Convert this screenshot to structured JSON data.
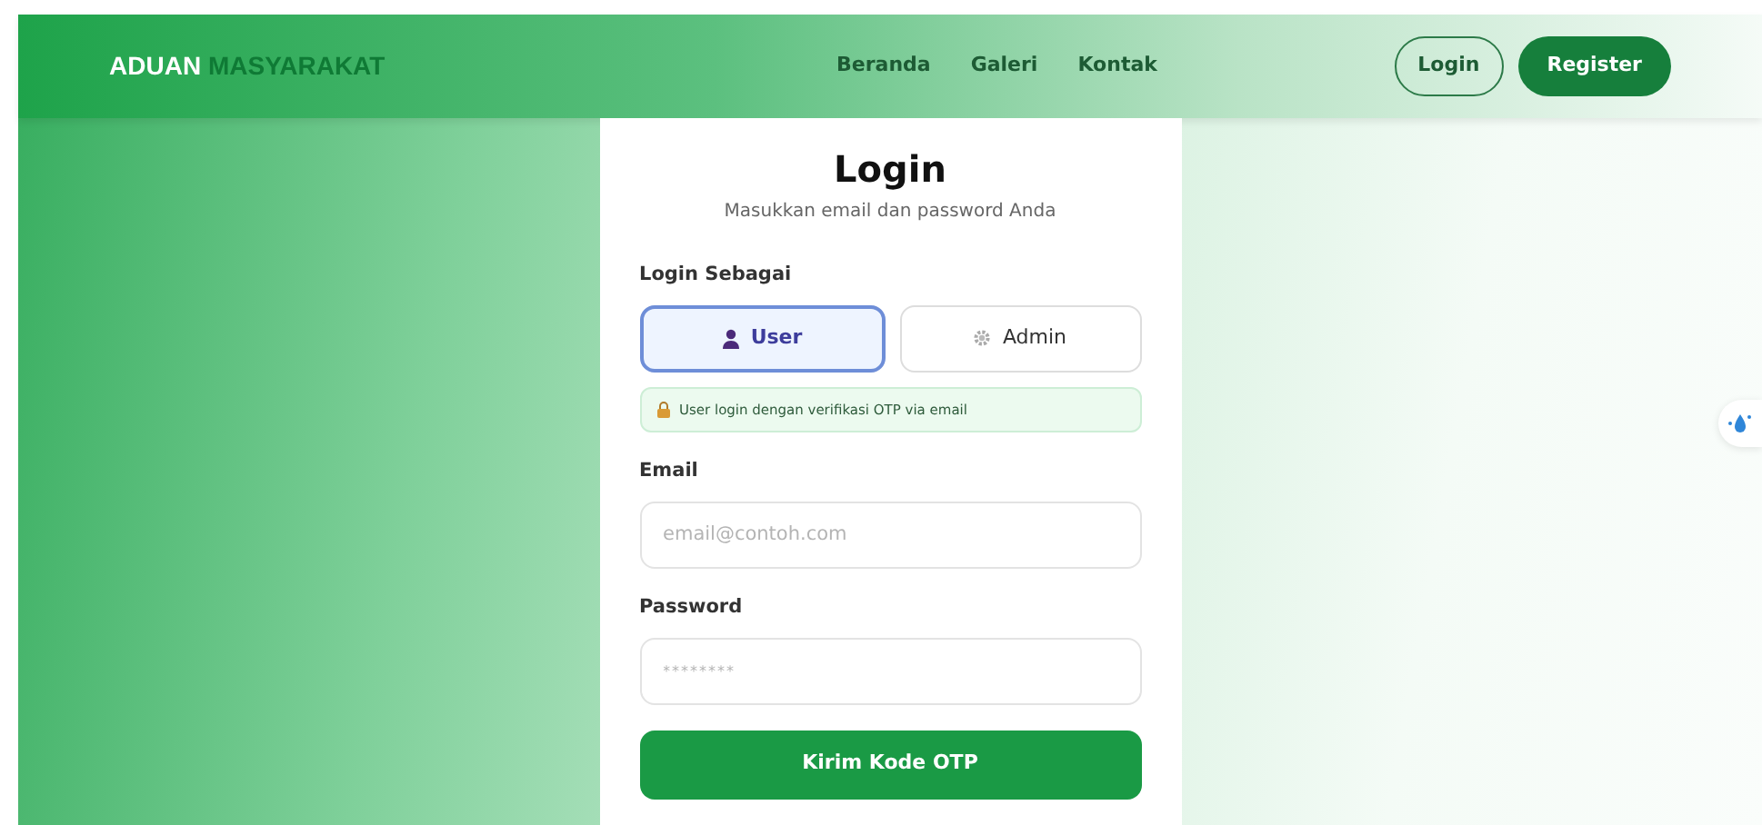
{
  "navbar": {
    "brand": {
      "first": "ADUAN",
      "second": "MASYARAKAT"
    },
    "links": [
      "Beranda",
      "Galeri",
      "Kontak"
    ],
    "buttons": [
      {
        "label": "Login",
        "kind": "outline"
      },
      {
        "label": "Register",
        "kind": "solid"
      }
    ]
  },
  "login": {
    "title": "Login",
    "subtitle": "Masukkan email dan password Anda",
    "role_label": "Login Sebagai",
    "roles": [
      {
        "label": "User",
        "kind": "user",
        "selected": true
      },
      {
        "label": "Admin",
        "kind": "admin",
        "selected": false
      }
    ],
    "info": "User login dengan verifikasi OTP via email",
    "fields": [
      {
        "label": "Email",
        "placeholder": "email@contoh.com",
        "kind": "email"
      },
      {
        "label": "Password",
        "placeholder": "********",
        "kind": "password"
      }
    ],
    "submit": "Kirim Kode OTP"
  }
}
